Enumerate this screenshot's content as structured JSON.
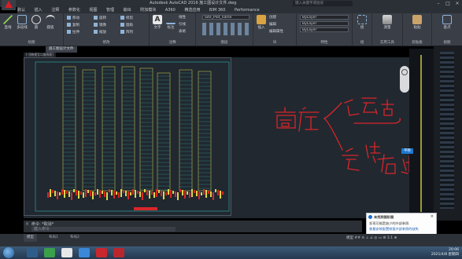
{
  "window": {
    "title": "Autodesk AutoCAD 2016  施工图设计文件.dwg",
    "search_placeholder": "键入关键字或短语"
  },
  "menu": [
    "默认",
    "插入",
    "注释",
    "参数化",
    "视图",
    "管理",
    "输出",
    "附加模块",
    "A360",
    "精选应用",
    "BIM 360",
    "Performance"
  ],
  "ribbon": {
    "groups": [
      {
        "label": "绘图",
        "big": [
          "直线",
          "多段线",
          "圆",
          "圆弧"
        ]
      },
      {
        "label": "修改",
        "small": [
          "移动",
          "旋转",
          "修剪",
          "复制",
          "镜像",
          "圆角",
          "拉伸",
          "缩放",
          "阵列"
        ]
      },
      {
        "label": "注释",
        "big": [
          "文字",
          "标注"
        ],
        "small": [
          "线性",
          "引线",
          "表格"
        ]
      },
      {
        "label": "图层",
        "layer_dropdown": "Site_Plot_name"
      },
      {
        "label": "块",
        "big": [
          "插入"
        ],
        "small": [
          "创建",
          "编辑",
          "编辑属性"
        ]
      },
      {
        "label": "特性",
        "dropdowns": [
          "ByLayer",
          "ByLayer",
          "ByLayer"
        ]
      },
      {
        "label": "组",
        "big": [
          "组"
        ]
      },
      {
        "label": "实用工具",
        "big": [
          "测量"
        ]
      },
      {
        "label": "剪贴板",
        "big": [
          "粘贴"
        ]
      },
      {
        "label": "视图",
        "big": [
          "基点"
        ]
      }
    ]
  },
  "tabs": {
    "file_tab": "施工图设计文件",
    "drawing_tab": "[-][俯视][二维线框]"
  },
  "annotation": {
    "handwritten": [
      "商店",
      "运营",
      "定位",
      "客群"
    ]
  },
  "tooltip": "平移",
  "command": {
    "history": "命令: *取消*",
    "prompt": "键入命令"
  },
  "status": {
    "model_tab": "模型",
    "layout_tabs": [
      "布局1",
      "布局2"
    ],
    "tools": "模型  ##  ≡  ⊥  ∠  ◎  ▭  ⚙  1:1  ⊕"
  },
  "notification": {
    "title": "未找到图形图",
    "line1": "发现可能是缺少的外部参照.",
    "line2": "查看安装配置修复外部参照的缺失"
  },
  "taskbar": {
    "time": "20:06",
    "date": "2021/4/8 星期四"
  },
  "colors": {
    "canvas_bg": "#212830",
    "accent_red": "#d41f25",
    "building_yellow": "#d9d94a",
    "ink_red": "#d8262a"
  }
}
